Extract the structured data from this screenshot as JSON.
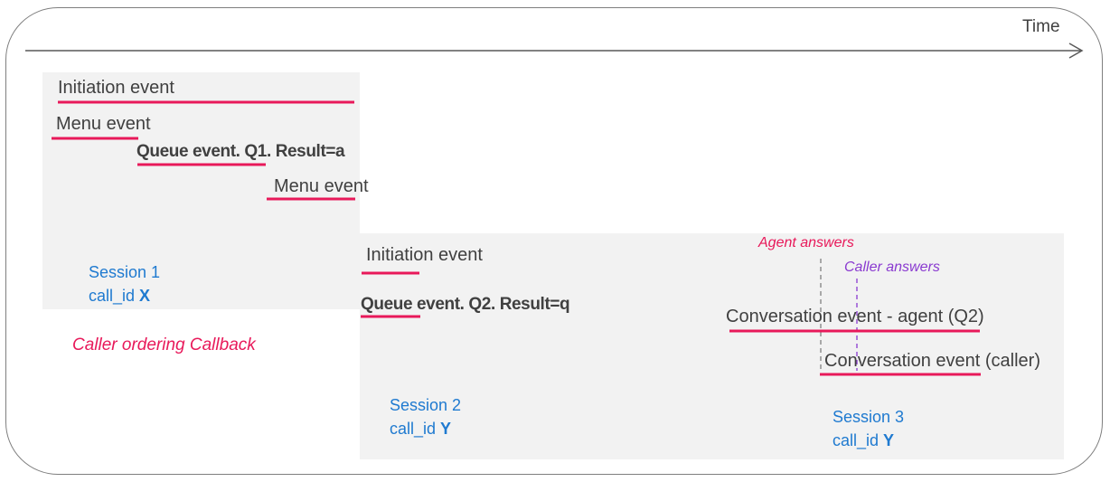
{
  "time_label": "Time",
  "session_1": {
    "events": {
      "initiation": "Initiation event",
      "menu_1": "Menu event",
      "queue": "Queue event. Q1. Result=a",
      "menu_2": "Menu event"
    },
    "name": "Session 1",
    "call_id_label": "call_id",
    "call_id_value": "X",
    "note": "Caller ordering Callback"
  },
  "session_2": {
    "events": {
      "initiation": "Initiation event",
      "queue": "Queue event. Q2. Result=q"
    },
    "name": "Session 2",
    "call_id_label": "call_id",
    "call_id_value": "Y"
  },
  "session_3": {
    "markers": {
      "agent_answers": "Agent answers",
      "caller_answers": "Caller answers"
    },
    "events": {
      "conversation_agent": "Conversation event - agent (Q2)",
      "conversation_caller": "Conversation event (caller)"
    },
    "name": "Session 3",
    "call_id_label": "call_id",
    "call_id_value": "Y"
  },
  "colors": {
    "event_underline": "#e8195a",
    "session_text": "#1f7ad0",
    "agent_marker": "#e8195a",
    "caller_marker": "#8a3ad0",
    "panel_fill": "#f2f2f2",
    "axis": "#595959"
  }
}
